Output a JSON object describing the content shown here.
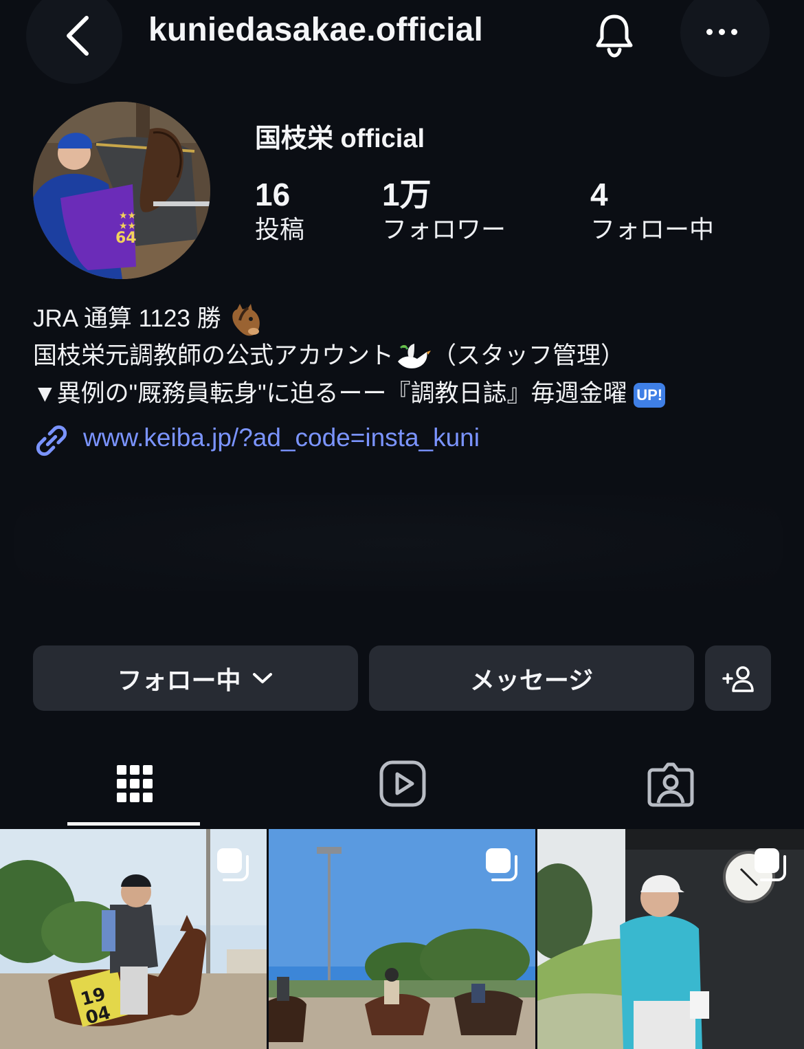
{
  "header": {
    "username": "kuniedasakae.official",
    "back_icon": "chevron-left-icon",
    "notification_icon": "bell-icon",
    "more_icon": "more-horizontal-icon"
  },
  "profile": {
    "display_name": "国枝栄 official",
    "stats": [
      {
        "value": "16",
        "label": "投稿"
      },
      {
        "value": "1万",
        "label": "フォロワー"
      },
      {
        "value": "4",
        "label": "フォロー中"
      }
    ]
  },
  "bio": {
    "line1": "JRA 通算 1123 勝",
    "line1_emoji": "horse-face-emoji",
    "line2_a": "国枝栄元調教師の公式アカウント",
    "line2_emoji": "dove-emoji",
    "line2_b": "（スタッフ管理）",
    "line3": "▼異例の\"厩務員転身\"に迫るーー『調教日誌』毎週金曜",
    "line3_badge": "UP!",
    "link": "www.keiba.jp/?ad_code=insta_kuni"
  },
  "actions": {
    "follow_label": "フォロー中",
    "message_label": "メッセージ",
    "add_person_icon": "add-person-icon"
  },
  "tabs": [
    {
      "name": "grid",
      "icon": "grid-icon",
      "active": true
    },
    {
      "name": "reels",
      "icon": "reels-icon",
      "active": false
    },
    {
      "name": "tagged",
      "icon": "tagged-icon",
      "active": false
    }
  ],
  "posts": [
    {
      "icon": "multiple-posts-icon",
      "number_cloth": "19\n04"
    },
    {
      "icon": "multiple-posts-icon"
    },
    {
      "icon": "multiple-posts-icon"
    }
  ],
  "colors": {
    "background": "#0b0e14",
    "button": "#272b33",
    "link": "#7b94ff",
    "badge": "#3f7fe6"
  }
}
